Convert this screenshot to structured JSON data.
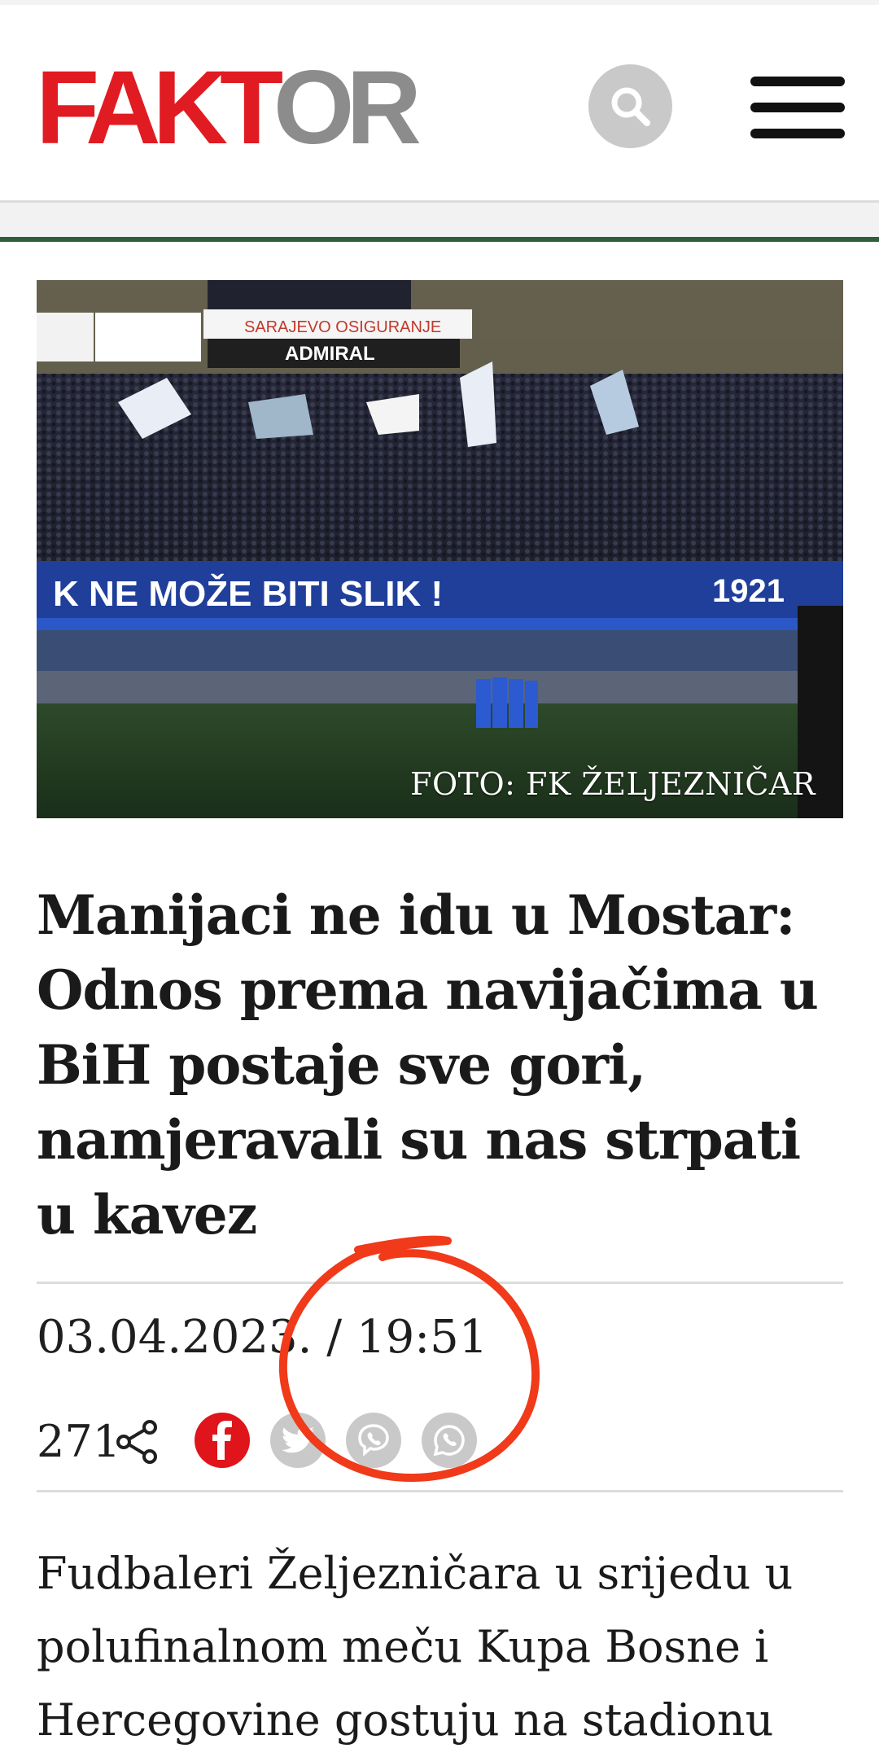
{
  "header": {
    "logo_part1": "FAKT",
    "logo_part2": "OR",
    "search_icon": "search-icon",
    "menu_icon": "hamburger-menu-icon",
    "brand_red": "#e11b22",
    "brand_gray": "#8c8c8c"
  },
  "article": {
    "photo_credit": "FOTO: FK ŽELJEZNIČAR",
    "title": "Manijaci ne idu u Mostar: Odnos prema navijačima u BiH postaje sve gori, namjeravali su nas strpati u kavez",
    "date": "03.04.2023.",
    "separator": "/",
    "time": "19:51",
    "share_count": "271",
    "share_icon": "share-icon",
    "social": [
      {
        "name": "facebook",
        "icon": "facebook-icon",
        "color": "#e0141b"
      },
      {
        "name": "twitter",
        "icon": "twitter-icon",
        "color": "#c9c9c9"
      },
      {
        "name": "viber",
        "icon": "viber-icon",
        "color": "#c9c9c9"
      },
      {
        "name": "whatsapp",
        "icon": "whatsapp-icon",
        "color": "#c9c9c9"
      }
    ],
    "body_lines": [
      "Fudbaleri Željezničara u srijedu u",
      "polufinalnom meču Kupa Bosne i",
      "Hercegovine gostuju na stadionu"
    ]
  },
  "annotation": {
    "type": "hand-drawn circle",
    "color": "#f03a1a"
  }
}
